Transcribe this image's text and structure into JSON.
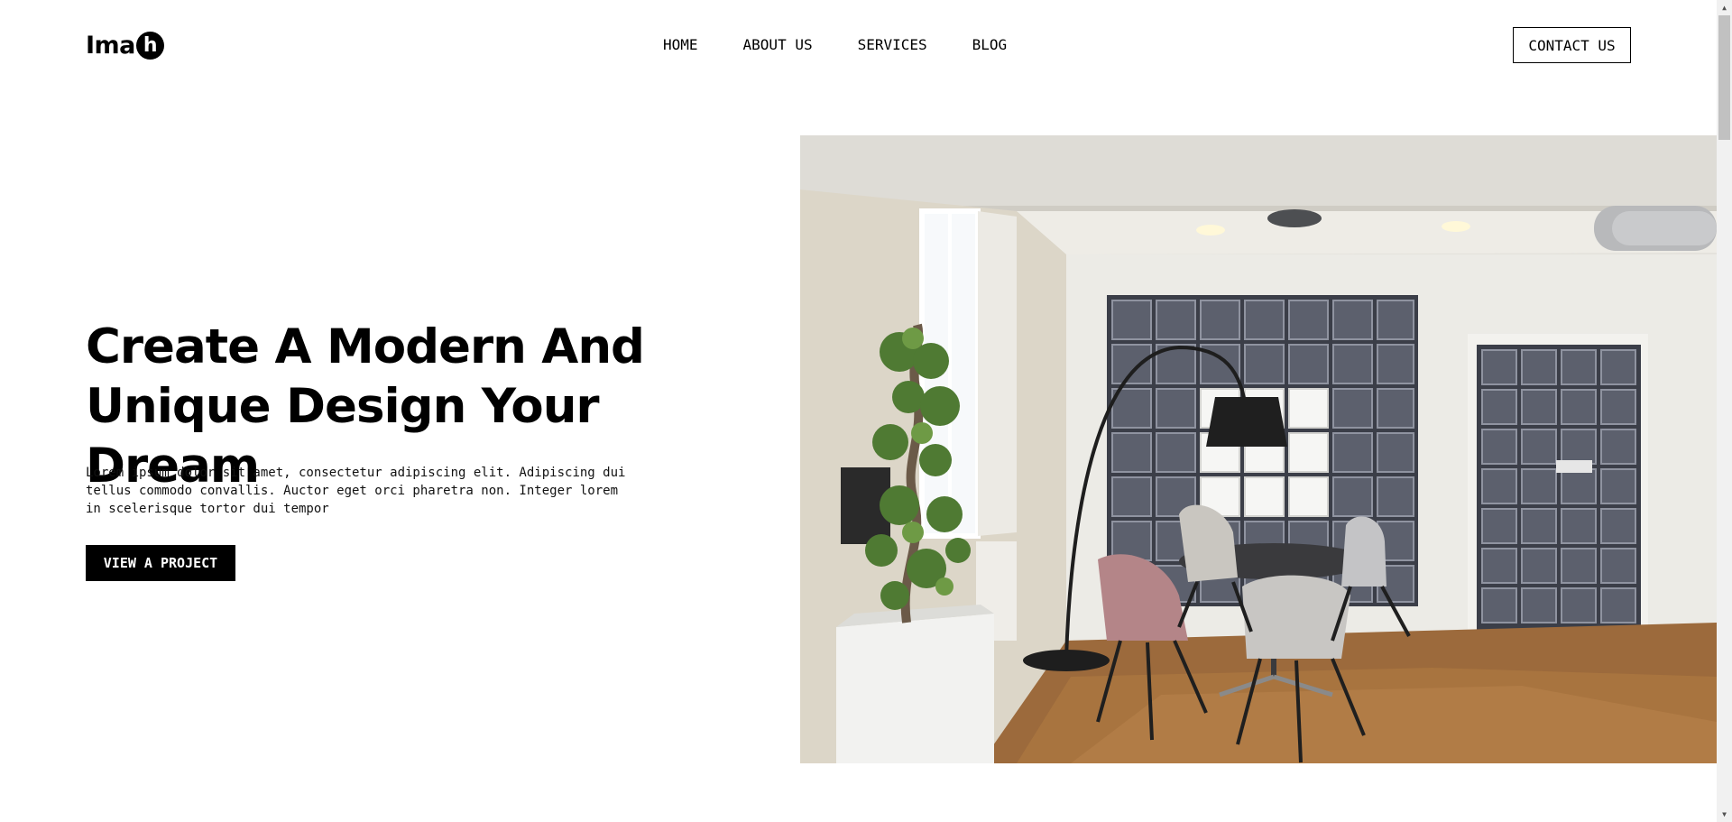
{
  "header": {
    "logo_text": "Ima",
    "logo_badge": "h",
    "nav": [
      {
        "label": "HOME"
      },
      {
        "label": "ABOUT US"
      },
      {
        "label": "SERVICES"
      },
      {
        "label": "BLOG"
      }
    ],
    "contact_label": "CONTACT US"
  },
  "hero": {
    "title": "Create A Modern And Unique Design Your Dream",
    "text": "Lorem ipsum dolor sit amet, consectetur adipiscing elit. Adipiscing dui tellus commodo convallis. Auctor eget orci pharetra non. Integer lorem in scelerisque tortor dui tempor",
    "button_label": "VIEW A PROJECT",
    "image_icon": "interior-photo"
  },
  "scrollbar": {
    "up_icon": "triangle-up-icon",
    "down_icon": "triangle-down-icon"
  }
}
